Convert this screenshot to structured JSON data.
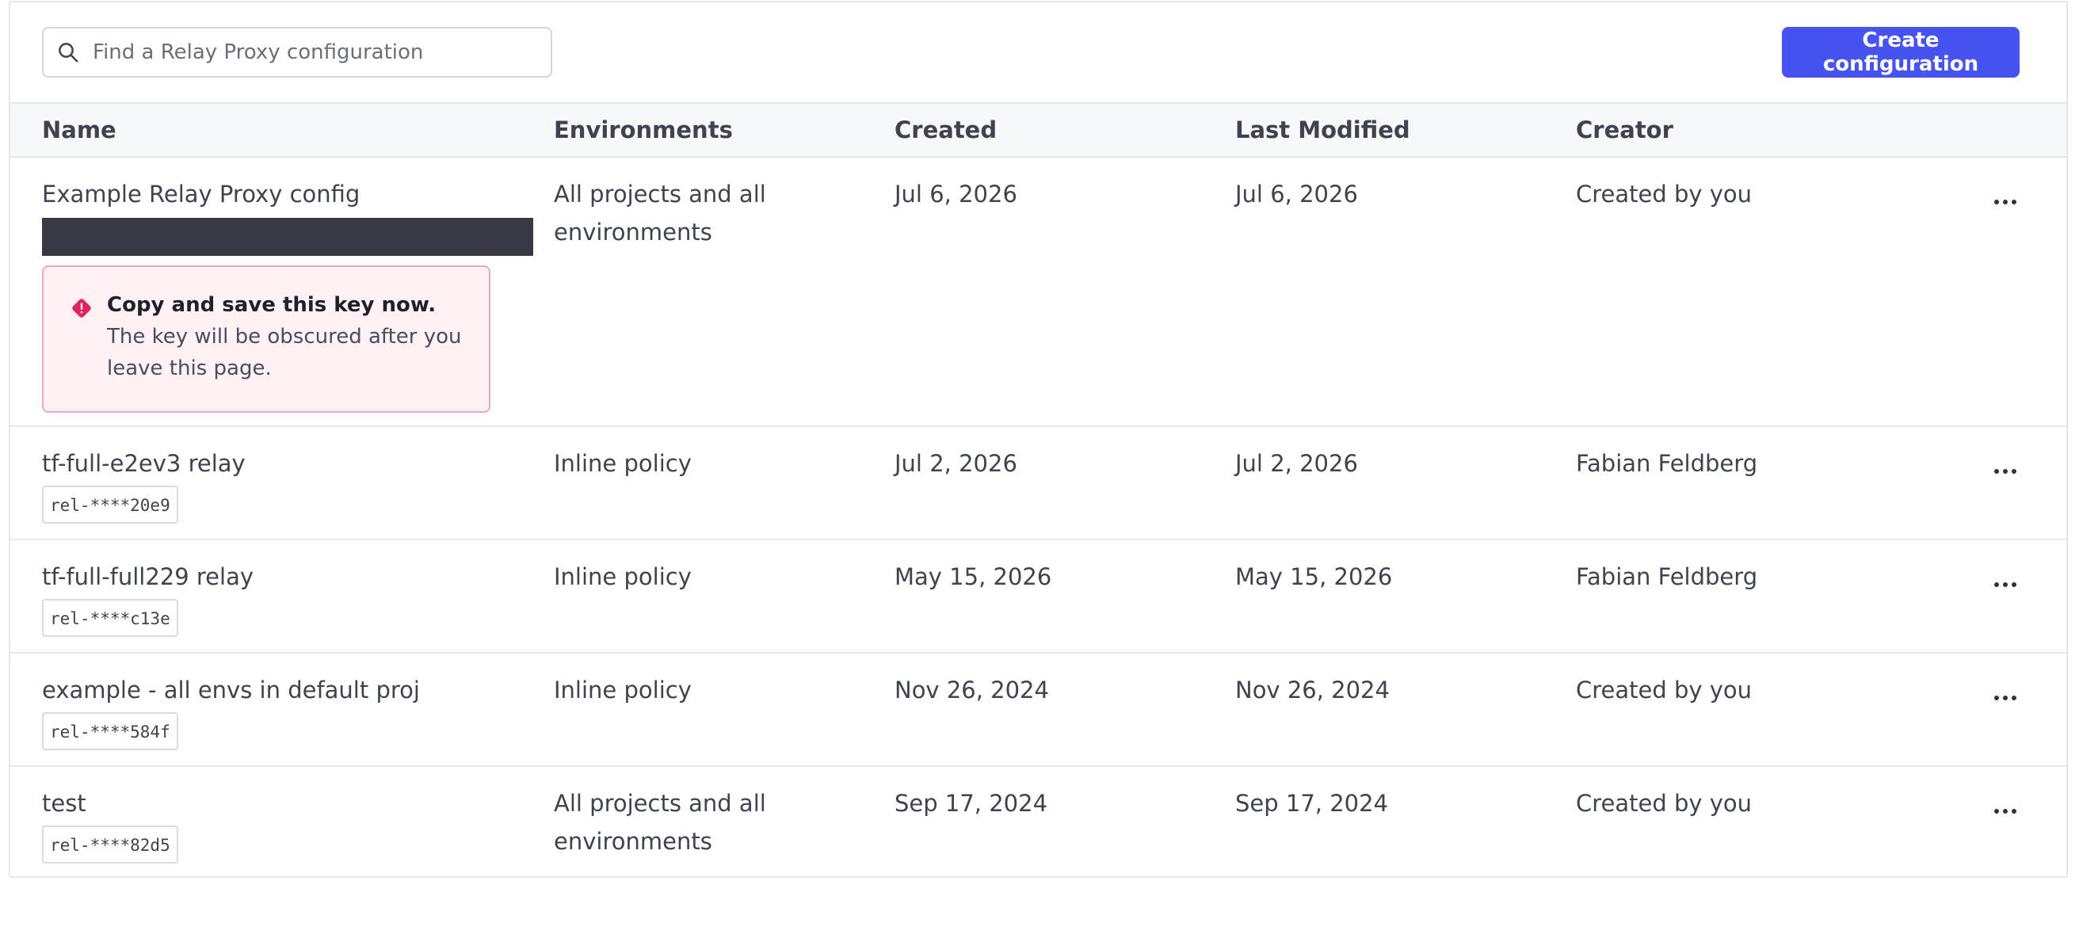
{
  "search": {
    "placeholder": "Find a Relay Proxy configuration"
  },
  "toolbar": {
    "create_label": "Create configuration"
  },
  "colors": {
    "accent": "#4653f0",
    "alert_border": "#f0a7b8",
    "alert_bg": "#fff1f4",
    "alert_icon": "#e0245e"
  },
  "table": {
    "headers": [
      "Name",
      "Environments",
      "Created",
      "Last Modified",
      "Creator"
    ],
    "rows": [
      {
        "name": "Example Relay Proxy config",
        "environments": "All projects and all environments",
        "created": "Jul 6, 2026",
        "modified": "Jul 6, 2026",
        "creator": "Created by you",
        "alert": {
          "title": "Copy and save this key now.",
          "body": "The key will be obscured after you leave this page."
        }
      },
      {
        "name": "tf-full-e2ev3 relay",
        "key": "rel-****20e9",
        "environments": "Inline policy",
        "created": "Jul 2, 2026",
        "modified": "Jul 2, 2026",
        "creator": "Fabian Feldberg"
      },
      {
        "name": "tf-full-full229 relay",
        "key": "rel-****c13e",
        "environments": "Inline policy",
        "created": "May 15, 2026",
        "modified": "May 15, 2026",
        "creator": "Fabian Feldberg"
      },
      {
        "name": "example - all envs in default proj",
        "key": "rel-****584f",
        "environments": "Inline policy",
        "created": "Nov 26, 2024",
        "modified": "Nov 26, 2024",
        "creator": "Created by you"
      },
      {
        "name": "test",
        "key": "rel-****82d5",
        "environments": "All projects and all environments",
        "created": "Sep 17, 2024",
        "modified": "Sep 17, 2024",
        "creator": "Created by you"
      }
    ]
  }
}
